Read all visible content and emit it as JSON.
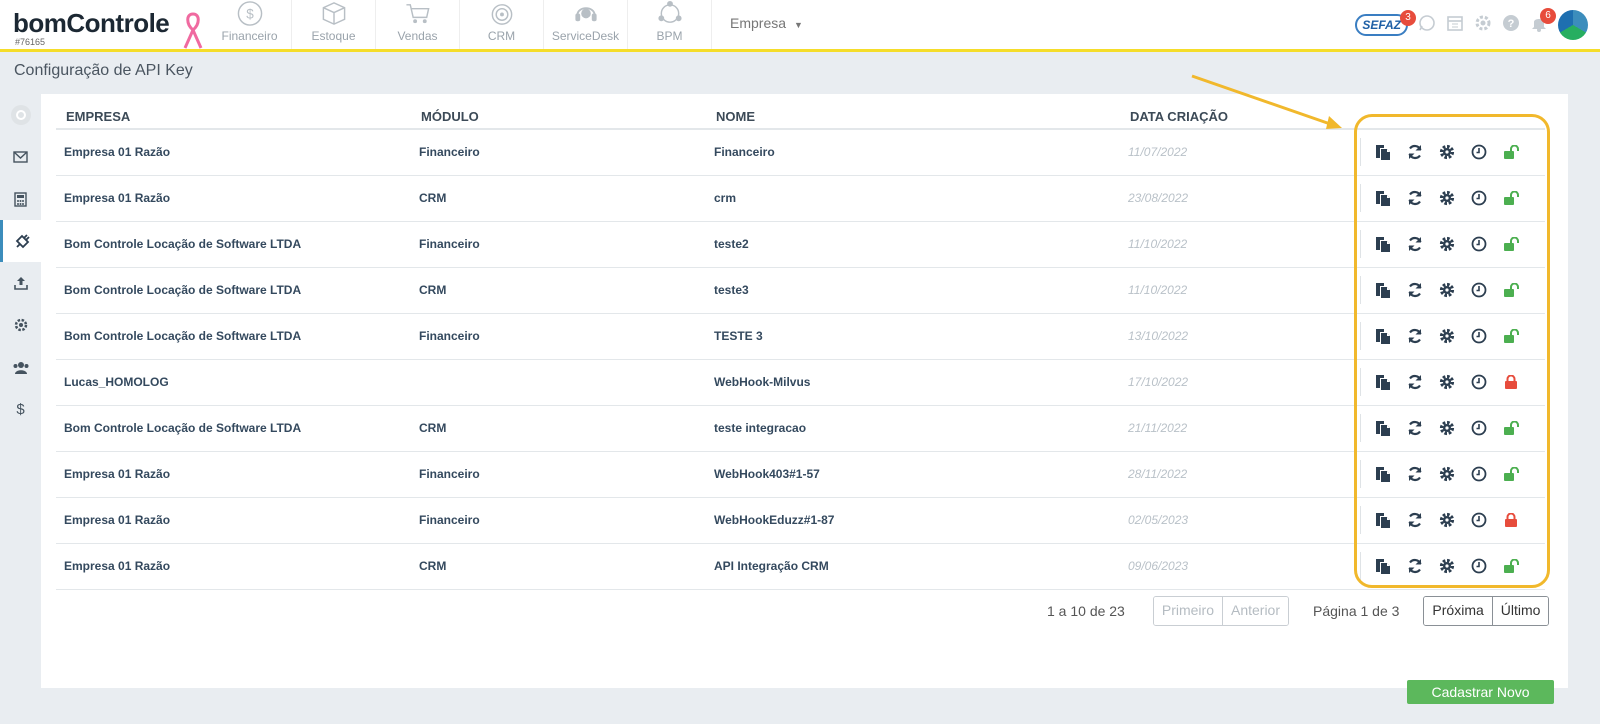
{
  "header": {
    "logo_text": "bomControle",
    "account_id": "#76165",
    "modules": [
      {
        "label": "Financeiro",
        "icon": "dollar-circle-icon"
      },
      {
        "label": "Estoque",
        "icon": "box-icon"
      },
      {
        "label": "Vendas",
        "icon": "cart-icon"
      },
      {
        "label": "CRM",
        "icon": "target-icon"
      },
      {
        "label": "ServiceDesk",
        "icon": "headset-icon"
      },
      {
        "label": "BPM",
        "icon": "network-icon"
      }
    ],
    "company_selector": "Empresa",
    "sefaz_label": "SEFAZ",
    "sefaz_badge": "3",
    "notifications_badge": "6"
  },
  "page": {
    "title": "Configuração de API Key"
  },
  "table": {
    "columns": [
      "EMPRESA",
      "MÓDULO",
      "NOME",
      "DATA CRIAÇÃO"
    ],
    "rows": [
      {
        "empresa": "Empresa 01 Razão",
        "modulo": "Financeiro",
        "nome": "Financeiro",
        "data": "11/07/2022",
        "lock": "unlocked"
      },
      {
        "empresa": "Empresa 01 Razão",
        "modulo": "CRM",
        "nome": "crm",
        "data": "23/08/2022",
        "lock": "unlocked"
      },
      {
        "empresa": "Bom Controle Locação de Software LTDA",
        "modulo": "Financeiro",
        "nome": "teste2",
        "data": "11/10/2022",
        "lock": "unlocked"
      },
      {
        "empresa": "Bom Controle Locação de Software LTDA",
        "modulo": "CRM",
        "nome": "teste3",
        "data": "11/10/2022",
        "lock": "unlocked"
      },
      {
        "empresa": "Bom Controle Locação de Software LTDA",
        "modulo": "Financeiro",
        "nome": "TESTE 3",
        "data": "13/10/2022",
        "lock": "unlocked"
      },
      {
        "empresa": "Lucas_HOMOLOG",
        "modulo": "",
        "nome": "WebHook-Milvus",
        "data": "17/10/2022",
        "lock": "locked"
      },
      {
        "empresa": "Bom Controle Locação de Software LTDA",
        "modulo": "CRM",
        "nome": "teste integracao",
        "data": "21/11/2022",
        "lock": "unlocked"
      },
      {
        "empresa": "Empresa 01 Razão",
        "modulo": "Financeiro",
        "nome": "WebHook403#1-57",
        "data": "28/11/2022",
        "lock": "unlocked"
      },
      {
        "empresa": "Empresa 01 Razão",
        "modulo": "Financeiro",
        "nome": "WebHookEduzz#1-87",
        "data": "02/05/2023",
        "lock": "locked"
      },
      {
        "empresa": "Empresa 01 Razão",
        "modulo": "CRM",
        "nome": "API Integração CRM",
        "data": "09/06/2023",
        "lock": "unlocked"
      }
    ]
  },
  "pagination": {
    "summary": "1 a 10 de 23",
    "first": "Primeiro",
    "previous": "Anterior",
    "page_info": "Página 1 de 3",
    "next": "Próxima",
    "last": "Último"
  },
  "actions": {
    "new_button": "Cadastrar Novo"
  },
  "colors": {
    "accent_yellow": "#f5dd2a",
    "highlight": "#f1b82c",
    "unlocked": "#4caf50",
    "locked": "#e74c3c",
    "primary_button": "#5cb85c"
  }
}
